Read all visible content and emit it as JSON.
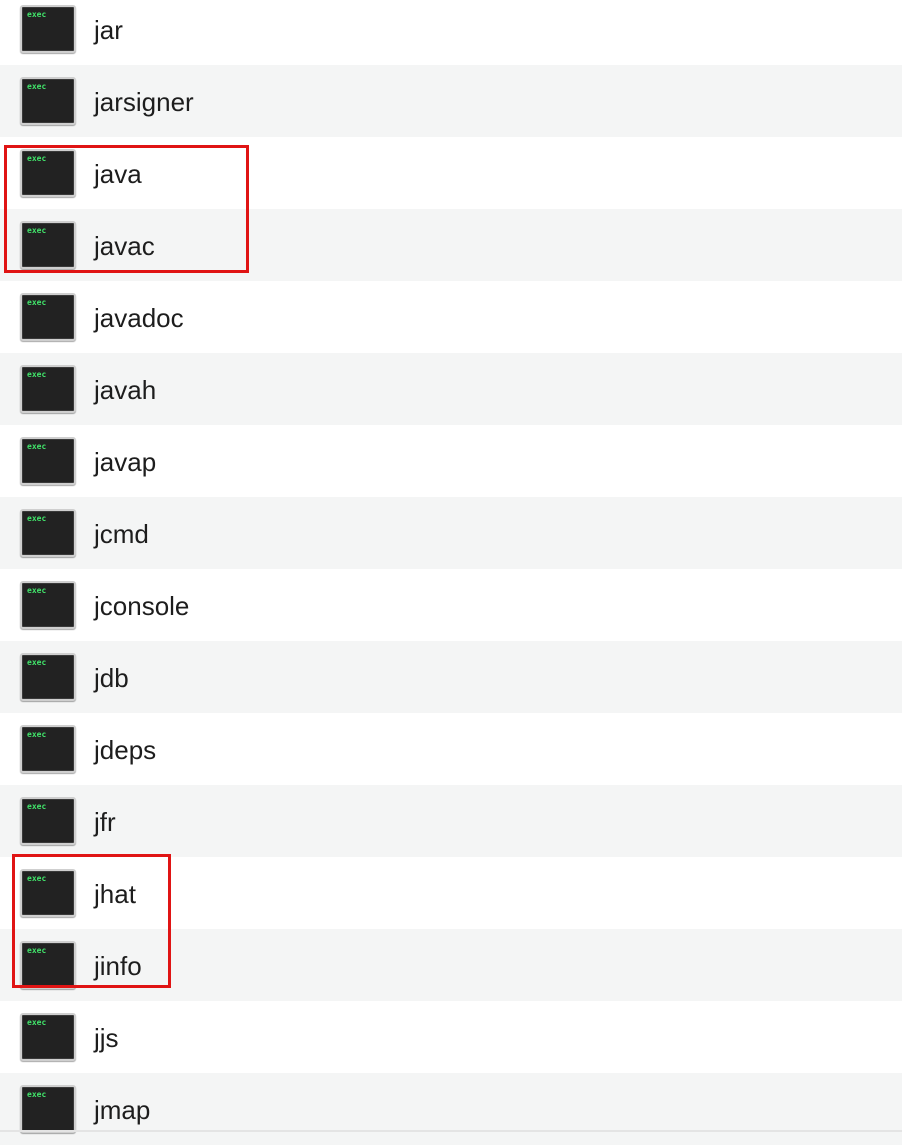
{
  "icon": {
    "badge_text": "exec",
    "name": "terminal-executable-icon",
    "badge_color": "#41e36a"
  },
  "files": [
    {
      "name": "jar"
    },
    {
      "name": "jarsigner"
    },
    {
      "name": "java"
    },
    {
      "name": "javac"
    },
    {
      "name": "javadoc"
    },
    {
      "name": "javah"
    },
    {
      "name": "javap"
    },
    {
      "name": "jcmd"
    },
    {
      "name": "jconsole"
    },
    {
      "name": "jdb"
    },
    {
      "name": "jdeps"
    },
    {
      "name": "jfr"
    },
    {
      "name": "jhat"
    },
    {
      "name": "jinfo"
    },
    {
      "name": "jjs"
    },
    {
      "name": "jmap"
    }
  ],
  "highlights": [
    {
      "items": [
        "java",
        "javac"
      ],
      "color": "#e01414"
    },
    {
      "items": [
        "jhat",
        "jinfo"
      ],
      "color": "#e01414"
    }
  ]
}
